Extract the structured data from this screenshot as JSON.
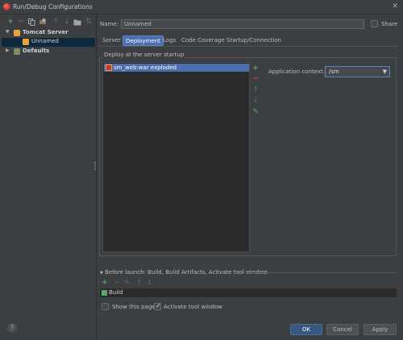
{
  "window": {
    "title": "Run/Debug Configurations",
    "close_glyph": "✕"
  },
  "left_toolbar": {
    "icons": [
      "add-icon",
      "remove-icon",
      "copy-icon",
      "settings-icon",
      "move-up-icon",
      "move-down-icon",
      "folder-icon",
      "sort-icon"
    ]
  },
  "tree": {
    "items": [
      {
        "label": "Tomcat Server",
        "expanded": true
      },
      {
        "label": "Unnamed",
        "selected": true
      },
      {
        "label": "Defaults",
        "expanded": false
      }
    ]
  },
  "name_field": {
    "label": "Name:",
    "value": "Unnamed"
  },
  "share": {
    "label": "Share",
    "checked": false
  },
  "tabs": [
    {
      "label": "Server",
      "active": false
    },
    {
      "label": "Deployment",
      "active": true
    },
    {
      "label": "Logs",
      "active": false
    },
    {
      "label": "Code Coverage",
      "active": false
    },
    {
      "label": "Startup/Connection",
      "active": false
    }
  ],
  "deployment": {
    "group_title": "Deploy at the server startup",
    "artifacts": [
      "sm_web:war exploded"
    ],
    "context_label": "Application context:",
    "context_value": "/sm"
  },
  "before_launch": {
    "title": "Before launch: Build, Build Artifacts, Activate tool window",
    "tasks": [
      "Build"
    ],
    "show_page_label": "Show this page",
    "show_page_checked": false,
    "activate_label": "Activate tool window",
    "activate_checked": true
  },
  "buttons": {
    "ok": "OK",
    "cancel": "Cancel",
    "apply": "Apply",
    "help": "?"
  },
  "colors": {
    "background": "#3c3f41",
    "selection": "#4b6eaf",
    "add": "#59a869",
    "remove": "#c75450"
  }
}
